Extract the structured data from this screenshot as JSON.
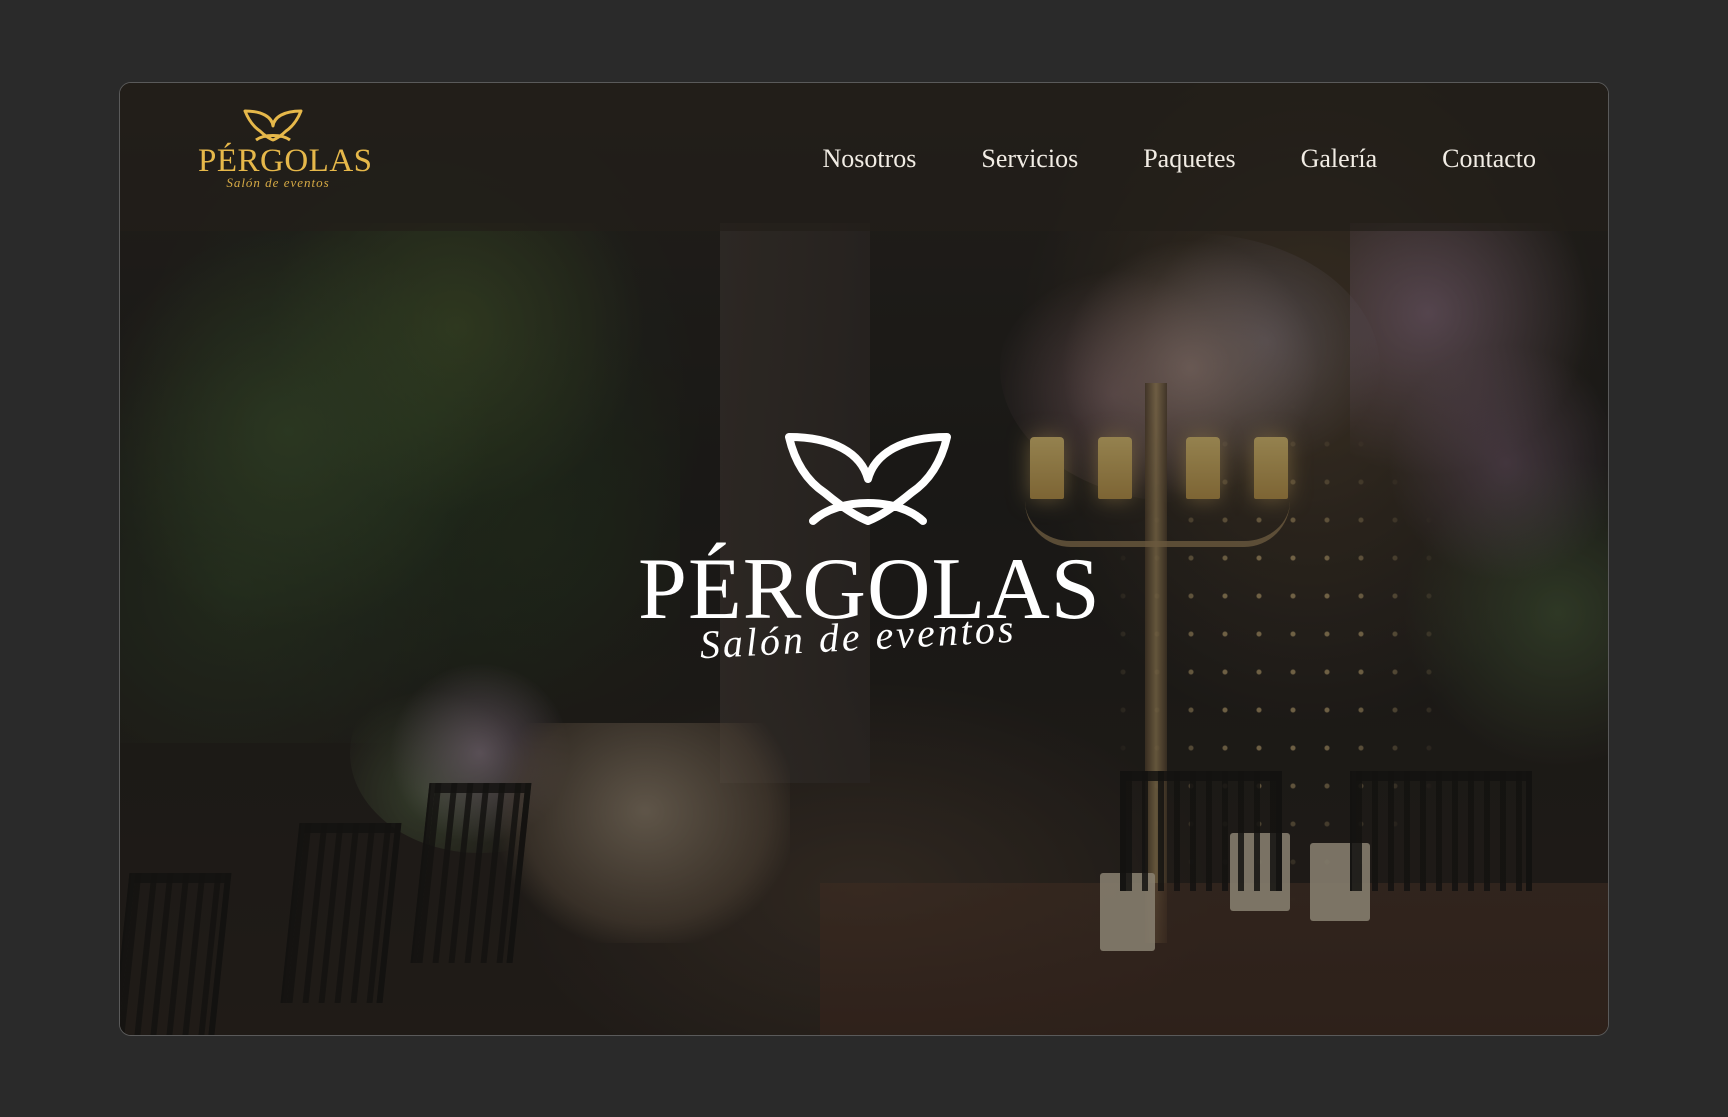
{
  "brand": {
    "name": "PÉRGOLAS",
    "tagline": "Salón de eventos",
    "logo_icon": "butterfly-icon",
    "color_gold": "#e6b84a",
    "color_white": "#ffffff"
  },
  "nav": {
    "items": [
      {
        "label": "Nosotros"
      },
      {
        "label": "Servicios"
      },
      {
        "label": "Paquetes"
      },
      {
        "label": "Galería"
      },
      {
        "label": "Contacto"
      }
    ]
  },
  "hero": {
    "name": "PÉRGOLAS",
    "tagline": "Salón de eventos",
    "background": "event-hall-photo"
  }
}
